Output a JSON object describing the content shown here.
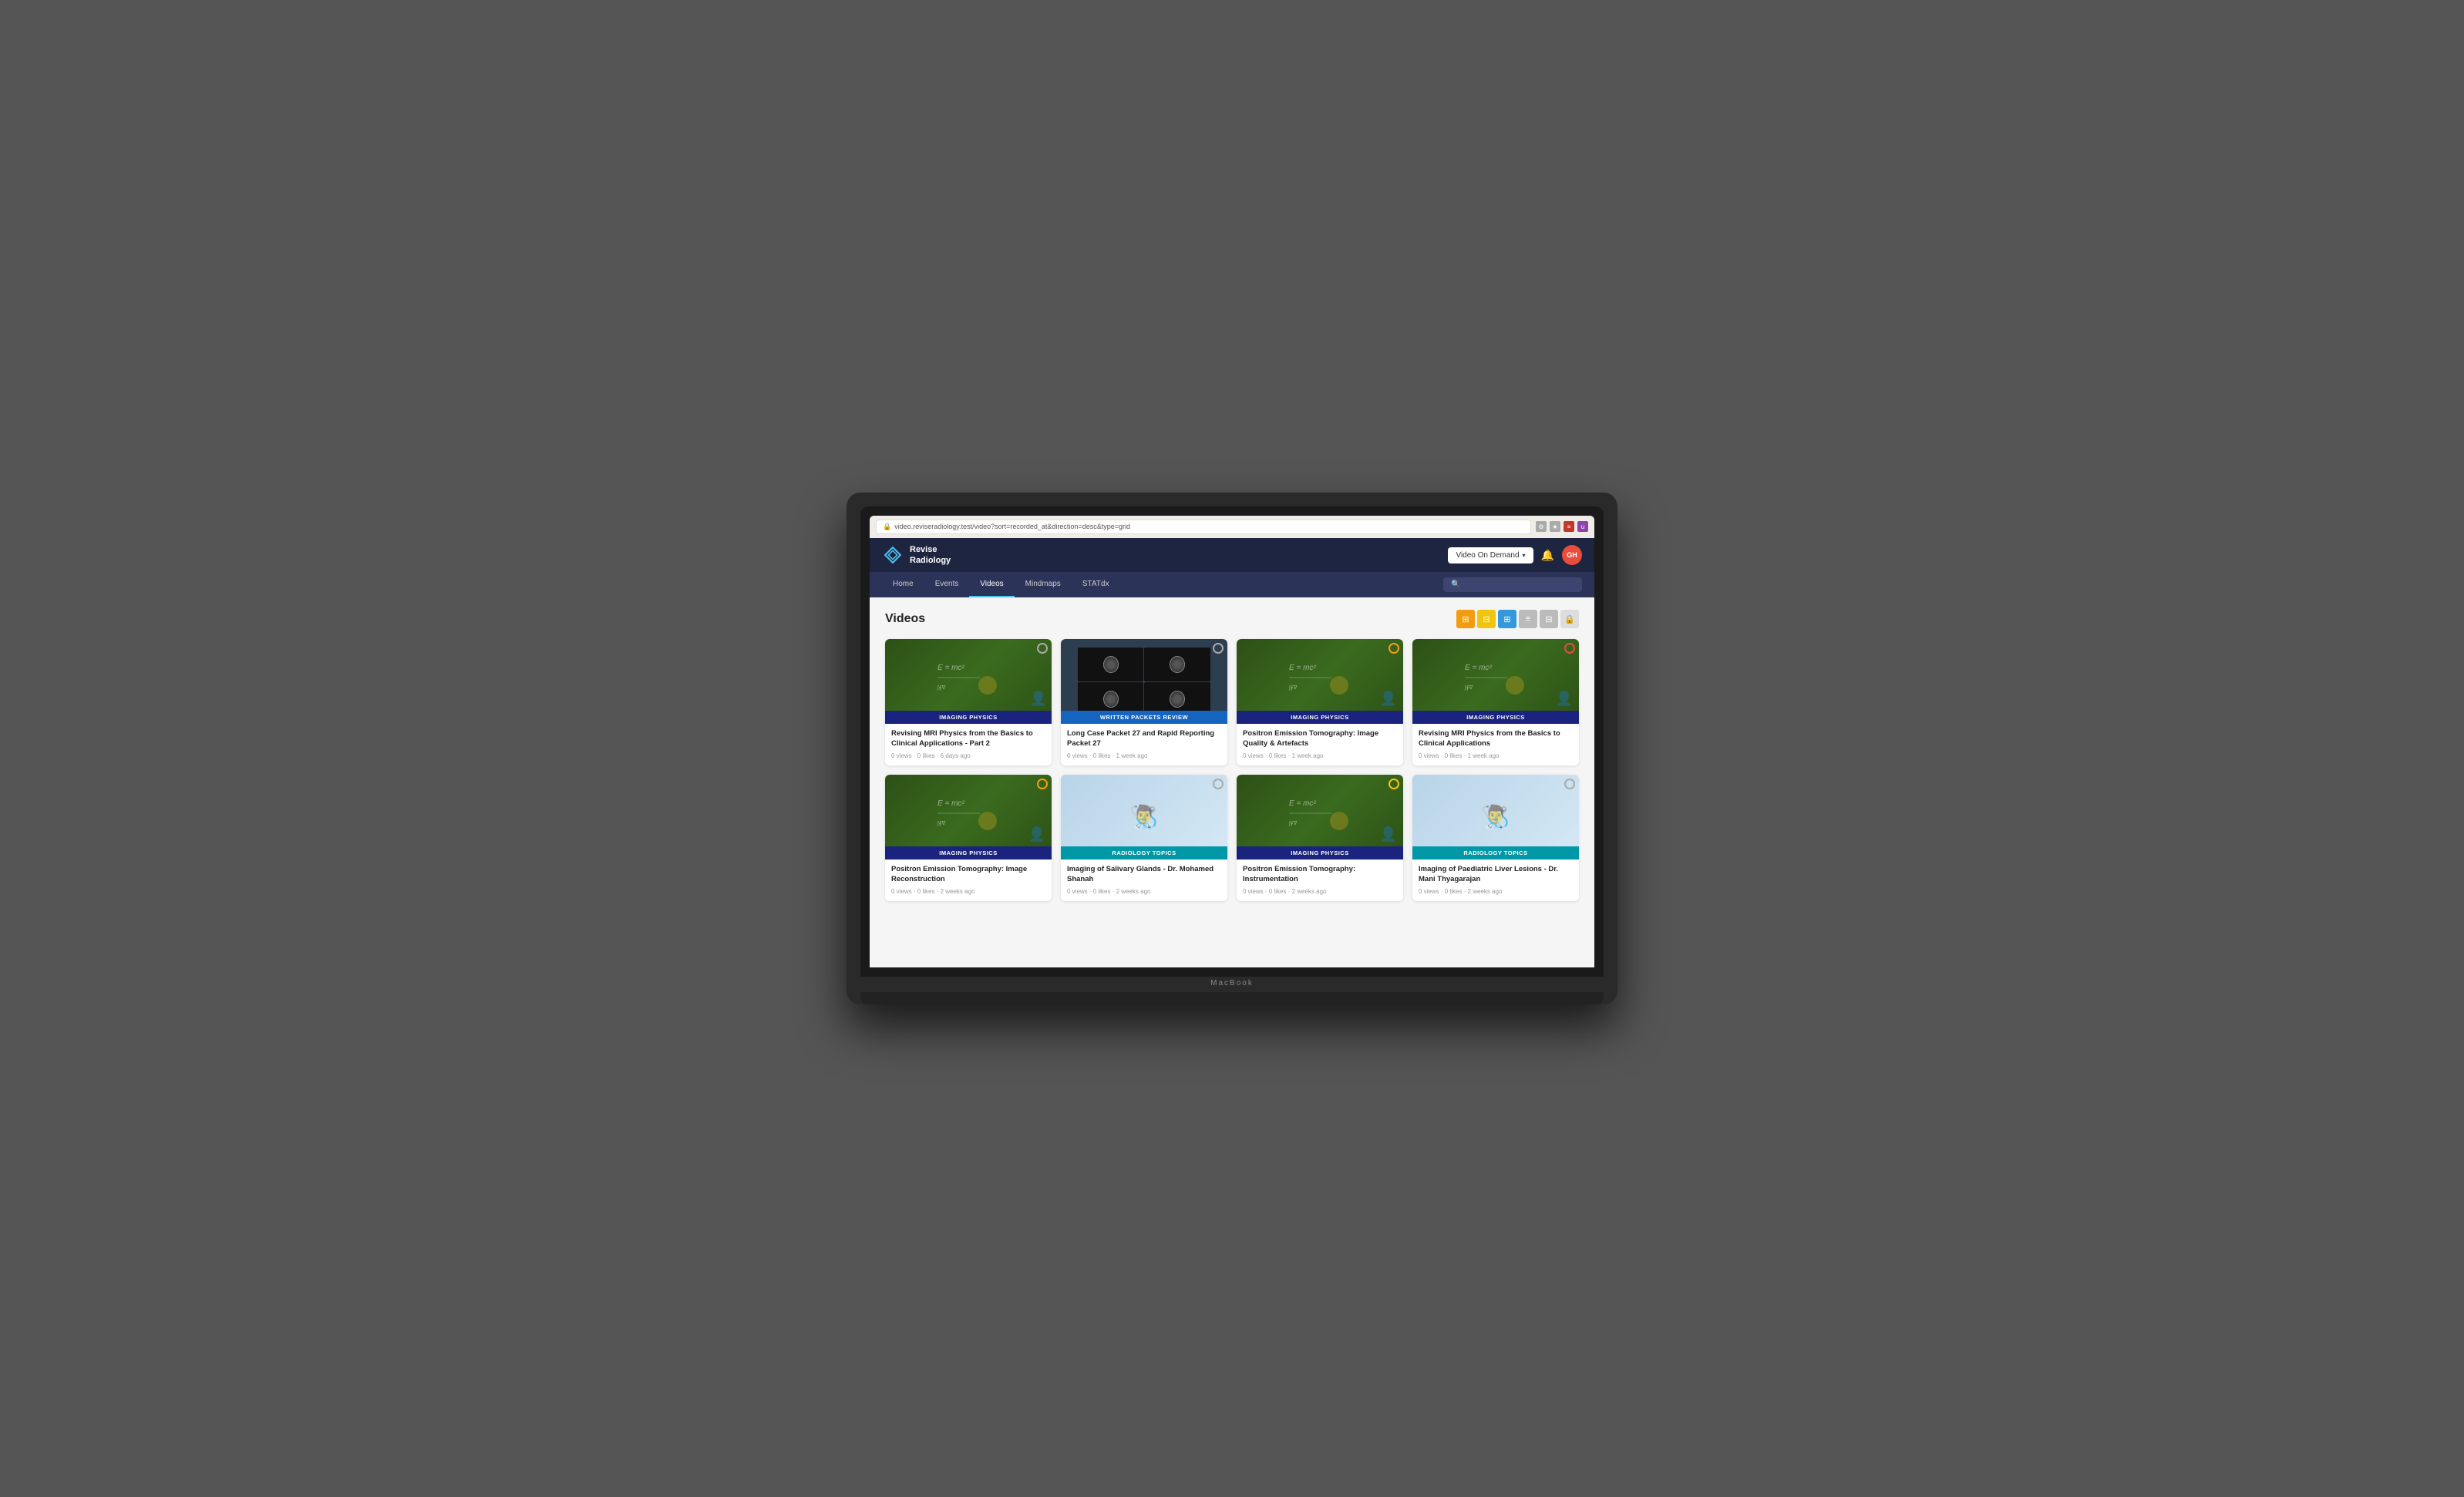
{
  "browser": {
    "url": "video.reviseradiology.test/video?sort=recorded_at&direction=desc&type=grid"
  },
  "logo": {
    "name": "Revise Radiology",
    "line1": "Revise",
    "line2": "Radiology"
  },
  "topnav": {
    "video_on_demand": "Video On Demand",
    "dropdown_arrow": "▾",
    "avatar_initials": "GH"
  },
  "nav_links": [
    {
      "label": "Home",
      "id": "home"
    },
    {
      "label": "Events",
      "id": "events"
    },
    {
      "label": "Videos",
      "id": "videos"
    },
    {
      "label": "Mindmaps",
      "id": "mindmaps"
    },
    {
      "label": "STATdx",
      "id": "statdx"
    }
  ],
  "search_placeholder": "",
  "page_title": "Videos",
  "view_buttons": [
    {
      "icon": "⊞",
      "type": "filter1",
      "style": "orange"
    },
    {
      "icon": "☰",
      "type": "filter2",
      "style": "yellow"
    },
    {
      "icon": "⊞",
      "type": "grid",
      "style": "blue-active"
    },
    {
      "icon": "≡",
      "type": "list",
      "style": "grey"
    },
    {
      "icon": "⊟",
      "type": "compact",
      "style": "grey"
    },
    {
      "icon": "🔒",
      "type": "lock",
      "style": "light"
    }
  ],
  "videos": [
    {
      "id": 1,
      "category": "IMAGING PHYSICS",
      "category_style": "navy",
      "title": "Revising MRI Physics from the Basics to Clinical Applications - Part 2",
      "meta": "0 views · 0 likes · 6 days ago",
      "thumb_type": "chalkboard",
      "badge_color": "grey"
    },
    {
      "id": 2,
      "category": "WRITTEN PACKETS REVIEW",
      "category_style": "blue-bright",
      "title": "Long Case Packet 27 and Rapid Reporting Packet 27",
      "meta": "0 views · 0 likes · 1 week ago",
      "thumb_type": "brain-scan",
      "badge_color": "grey"
    },
    {
      "id": 3,
      "category": "IMAGING PHYSICS",
      "category_style": "navy",
      "title": "Positron Emission Tomography: Image Quality & Artefacts",
      "meta": "0 views · 0 likes · 1 week ago",
      "thumb_type": "chalkboard",
      "badge_color": "orange"
    },
    {
      "id": 4,
      "category": "IMAGING PHYSICS",
      "category_style": "navy",
      "title": "Revising MRI Physics from the Basics to Clinical Applications",
      "meta": "0 views · 0 likes · 1 week ago",
      "thumb_type": "chalkboard",
      "badge_color": "red"
    },
    {
      "id": 5,
      "category": "IMAGING PHYSICS",
      "category_style": "navy",
      "title": "Positron Emission Tomography: Image Reconstruction",
      "meta": "0 views · 0 likes · 2 weeks ago",
      "thumb_type": "chalkboard",
      "badge_color": "orange"
    },
    {
      "id": 6,
      "category": "RADIOLOGY TOPICS",
      "category_style": "cyan",
      "title": "Imaging of Salivary Glands - Dr. Mohamed Shanah",
      "meta": "0 views · 0 likes · 2 weeks ago",
      "thumb_type": "doctor",
      "badge_color": "grey"
    },
    {
      "id": 7,
      "category": "IMAGING PHYSICS",
      "category_style": "navy",
      "title": "Positron Emission Tomography: Instrumentation",
      "meta": "0 views · 0 likes · 2 weeks ago",
      "thumb_type": "chalkboard",
      "badge_color": "yellow"
    },
    {
      "id": 8,
      "category": "RADIOLOGY TOPICS",
      "category_style": "cyan",
      "title": "Imaging of Paediatric Liver Lesions - Dr. Mani Thyagarajan",
      "meta": "0 views · 0 likes · 2 weeks ago",
      "thumb_type": "doctor",
      "badge_color": "grey"
    }
  ],
  "macbook_label": "MacBook"
}
